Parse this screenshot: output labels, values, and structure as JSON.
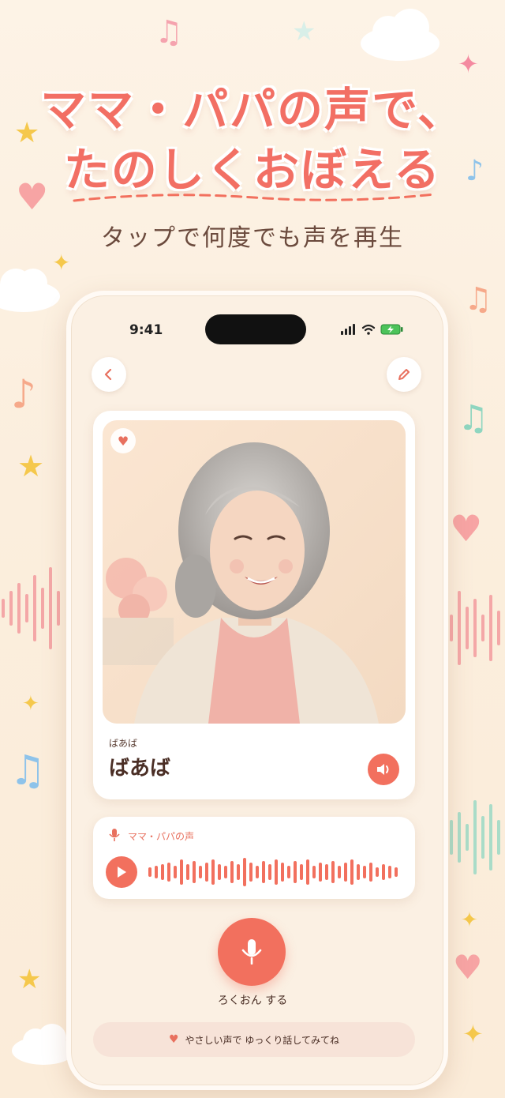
{
  "headline": {
    "line1": "ママ・パパの声で、",
    "line2": "たのしくおぼえる",
    "subtitle": "タップで何度でも声を再生"
  },
  "status_bar": {
    "time": "9:41"
  },
  "word_card": {
    "reading": "ばあば",
    "word": "ばあば"
  },
  "voice_card": {
    "label": "ママ・パパの声"
  },
  "record": {
    "label": "ろくおん する"
  },
  "tip": {
    "text": "やさしい声で ゆっくり話してみてね"
  },
  "colors": {
    "accent": "#f2705e",
    "text_dark": "#4a2e25",
    "background": "#fdf3e6"
  },
  "icons": [
    "back-icon",
    "edit-icon",
    "heart-icon",
    "speaker-icon",
    "mic-icon",
    "play-icon",
    "music-note-icon",
    "star-icon",
    "cloud-icon"
  ]
}
